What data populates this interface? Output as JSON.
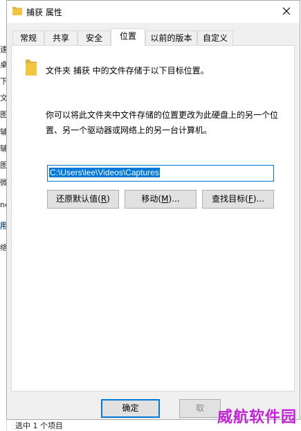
{
  "window": {
    "title": "捕获 属性",
    "close_glyph": "✕"
  },
  "tabs": [
    {
      "label": "常规",
      "active": false
    },
    {
      "label": "共享",
      "active": false
    },
    {
      "label": "安全",
      "active": false
    },
    {
      "label": "位置",
      "active": true
    },
    {
      "label": "以前的版本",
      "active": false
    },
    {
      "label": "自定义",
      "active": false
    }
  ],
  "location": {
    "folder_description": "文件夹 捕获 中的文件存储于以下目标位置。",
    "explanation": "你可以将此文件夹中文件存储的位置更改为此硬盘上的另一个位置、另一个驱动器或网络上的另一台计算机。",
    "path_value": "C:\\Users\\lee\\Videos\\Captures",
    "restore_default_label": "还原默认值",
    "restore_default_key": "R",
    "move_label": "移动",
    "move_key": "M",
    "find_target_label": "查找目标",
    "find_target_key": "F"
  },
  "footer": {
    "ok_label": "确定",
    "cancel_label": "取"
  },
  "background": {
    "side_chars": [
      "速",
      "桌",
      "下",
      "文",
      "图",
      "辅",
      "辅",
      "图",
      "微",
      "ne",
      "用",
      "络"
    ],
    "status_text": "选中 1 个项目"
  },
  "watermark": "威航软件园",
  "colors": {
    "accent": "#0078d7",
    "dialog_bg": "#f0f0f0",
    "button_bg": "#e1e1e1",
    "folder": "#f3c63f",
    "watermark": "#c026d3"
  }
}
